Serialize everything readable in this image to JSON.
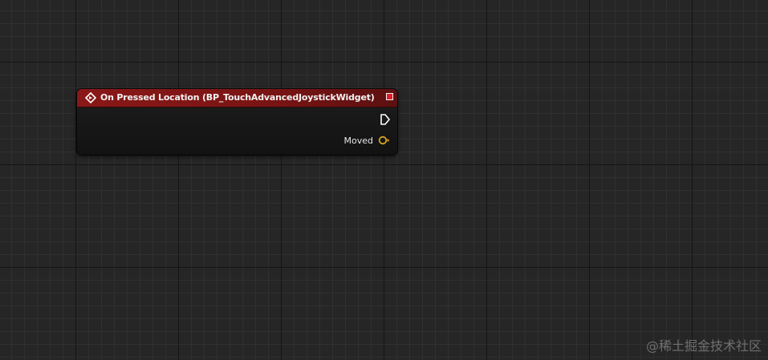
{
  "node": {
    "title": "On Pressed Location (BP_TouchAdvancedJoystickWidget)",
    "header_icon": "event-diamond-icon",
    "delegate_pin_icon": "delegate-square-icon",
    "exec_pin_icon": "exec-output-arrow-icon",
    "output_pins": [
      {
        "label": "Moved",
        "type": "boolean",
        "icon": "boolean-pin-icon"
      }
    ]
  },
  "colors": {
    "header": "#8a1818",
    "delegate_pin": "#e01c2a",
    "exec_pin": "#ffffff",
    "bool_pin": "#d6a21e",
    "background": "#262626"
  },
  "watermark": "@稀土掘金技术社区"
}
